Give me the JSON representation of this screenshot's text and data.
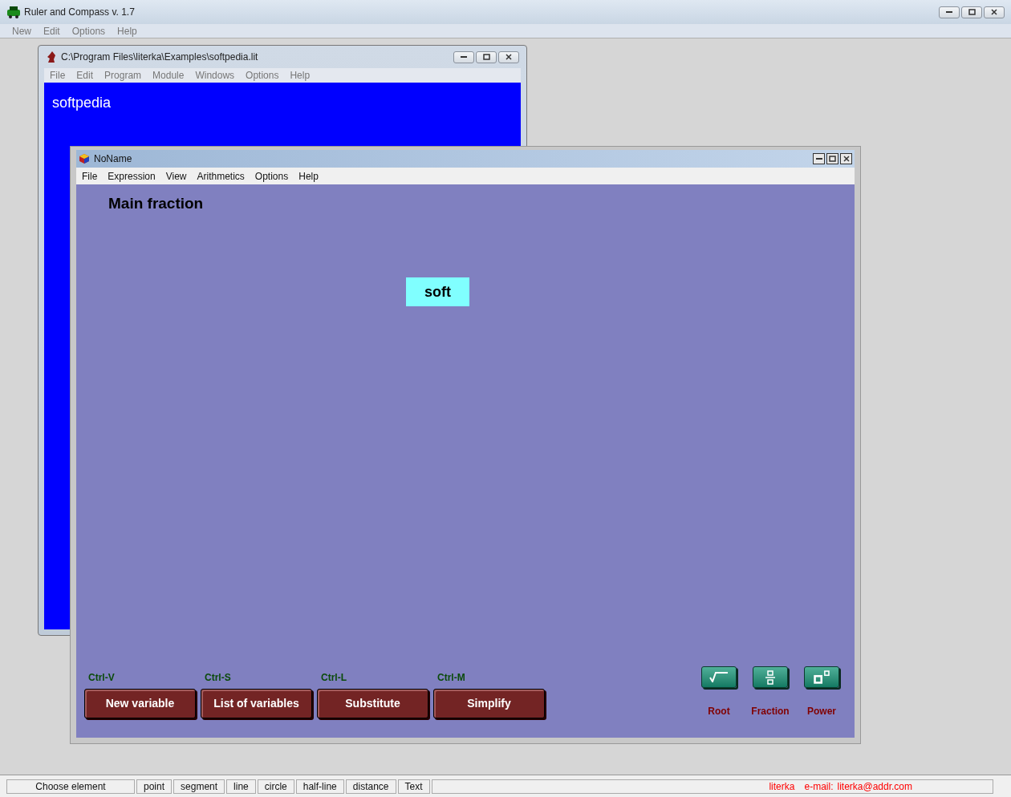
{
  "window": {
    "title": "Ruler and Compass v. 1.7"
  },
  "menu": [
    "New",
    "Edit",
    "Options",
    "Help"
  ],
  "program_window": {
    "title": "C:\\Program Files\\literka\\Examples\\softpedia.lit",
    "menu": [
      "File",
      "Edit",
      "Program",
      "Module",
      "Windows",
      "Options",
      "Help"
    ],
    "text": "softpedia"
  },
  "editor": {
    "title": "NoName",
    "menu": [
      "File",
      "Expression",
      "View",
      "Arithmetics",
      "Options",
      "Help"
    ],
    "heading": "Main fraction",
    "node": "soft",
    "actions": [
      {
        "shortcut": "Ctrl-V",
        "label": "New variable"
      },
      {
        "shortcut": "Ctrl-S",
        "label": "List of variables"
      },
      {
        "shortcut": "Ctrl-L",
        "label": "Substitute"
      },
      {
        "shortcut": "Ctrl-M",
        "label": "Simplify"
      }
    ],
    "tools": [
      {
        "kind": "root",
        "label": "Root"
      },
      {
        "kind": "fraction",
        "label": "Fraction"
      },
      {
        "kind": "power",
        "label": "Power"
      }
    ]
  },
  "status_bar": {
    "cells": [
      "Choose element",
      "point",
      "segment",
      "line",
      "circle",
      "half-line",
      "distance",
      "Text"
    ],
    "author": "literka",
    "email_label": "e-mail:",
    "email": "literka@addr.com"
  }
}
